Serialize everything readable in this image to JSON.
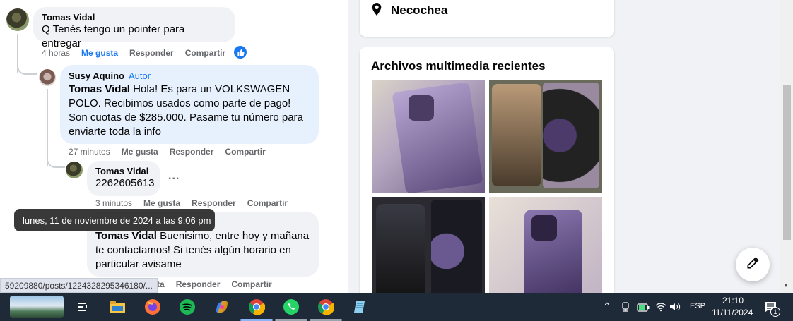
{
  "comments": [
    {
      "author": "Tomas Vidal",
      "text": "Q Tenés tengo un pointer para entregar",
      "time": "4 horas",
      "like": "Me gusta",
      "reply": "Responder",
      "share": "Compartir"
    },
    {
      "author": "Susy Aquino",
      "author_tag": "Autor",
      "mention": "Tomas Vidal",
      "text": " Hola! Es para un VOLKSWAGEN POLO. Recibimos usados como parte de pago! Son cuotas de $285.000. Pasame tu número para enviarte toda la info",
      "time": "27 minutos",
      "like": "Me gusta",
      "reply": "Responder",
      "share": "Compartir"
    },
    {
      "author": "Tomas Vidal",
      "text": "2262605613",
      "more": "...",
      "time": "3 minutos",
      "like": "Me gusta",
      "reply": "Responder",
      "share": "Compartir"
    },
    {
      "mention": "Tomas Vidal",
      "text": " Buenisimo, entre hoy y mañana te contactamos! Si tenés algún horario en particular avisame",
      "like": "usta",
      "reply": "Responder",
      "share": "Compartir"
    }
  ],
  "tooltip": "lunes, 11 de noviembre de 2024 a las 9:06 pm",
  "status_url": "59209880/posts/1224328295346180/...",
  "location": "Necochea",
  "media": {
    "title": "Archivos multimedia recientes"
  },
  "tray": {
    "language": "ESP",
    "time": "21:10",
    "date": "11/11/2024",
    "notification_count": "1"
  },
  "colors": {
    "accent": "#1877f2",
    "taskbar": "#1f2a38"
  }
}
